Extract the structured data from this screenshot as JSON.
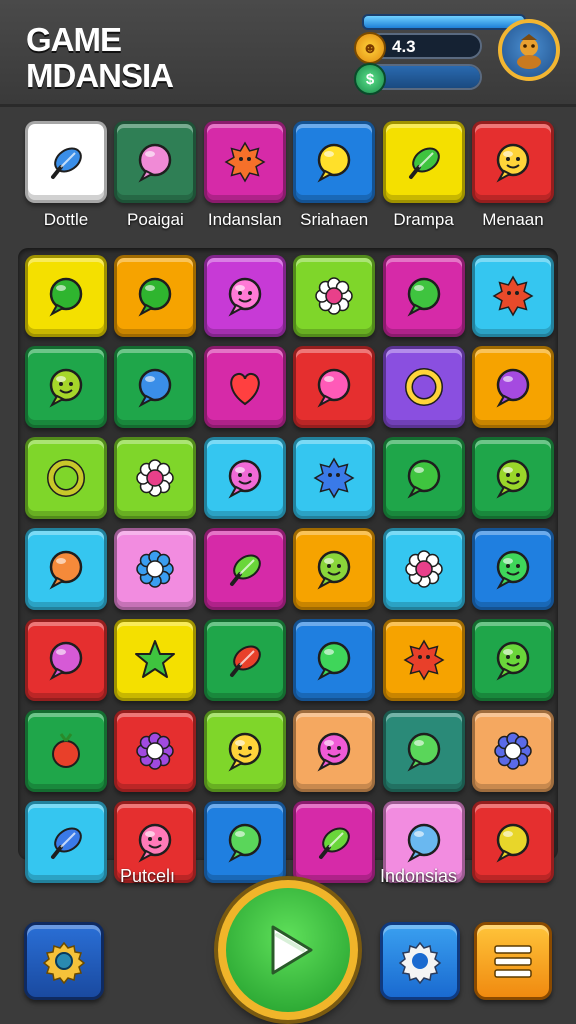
{
  "header": {
    "title_line1": "GAME",
    "title_line2": "MDANSIA",
    "rating_value": "4.3",
    "rating_icon": "star-face-icon",
    "energy_icon": "energy-coin-icon",
    "avatar_icon": "character-avatar-icon"
  },
  "colors": {
    "yellow": "#f4e000",
    "orange": "#f6a300",
    "purple": "#c73ad6",
    "lime": "#7fd62a",
    "magenta": "#d62aa8",
    "cyan": "#35c6f0",
    "green": "#1fa64a",
    "darkgreen": "#2f7f55",
    "red": "#e52f2f",
    "blue": "#1f7fe0",
    "pink": "#f28ce0",
    "violet": "#8a4fe0",
    "white": "#ffffff",
    "peach": "#f5a860",
    "teal": "#2a8a78"
  },
  "categories": [
    {
      "label": "Dottle",
      "color": "white",
      "icon": "blue-fish-icon"
    },
    {
      "label": "Poaigai",
      "color": "darkgreen",
      "icon": "pink-blob-icon"
    },
    {
      "label": "Indanslan",
      "color": "magenta",
      "icon": "orange-sun-icon"
    },
    {
      "label": "Sriahaen",
      "color": "blue",
      "icon": "yellow-bubble-icon"
    },
    {
      "label": "Drampa",
      "color": "yellow",
      "icon": "green-leaf-icon"
    },
    {
      "label": "Menaan",
      "color": "red",
      "icon": "smiley-face-icon"
    }
  ],
  "board": [
    [
      {
        "color": "yellow",
        "icon": "green-bubble-icon",
        "glyph": "#2fb52f"
      },
      {
        "color": "orange",
        "icon": "green-bubble-icon",
        "glyph": "#2fb52f"
      },
      {
        "color": "purple",
        "icon": "pink-smiley-icon",
        "glyph": "#ff7ad6"
      },
      {
        "color": "lime",
        "icon": "white-flower-icon",
        "glyph": "#ffffff"
      },
      {
        "color": "magenta",
        "icon": "green-bubble-icon",
        "glyph": "#3fc43f"
      },
      {
        "color": "cyan",
        "icon": "red-splat-icon",
        "glyph": "#e84a2a"
      }
    ],
    [
      {
        "color": "green",
        "icon": "smiley-face-icon",
        "glyph": "#a6d62a"
      },
      {
        "color": "green",
        "icon": "blue-bubble-icon",
        "glyph": "#3a8ee8"
      },
      {
        "color": "magenta",
        "icon": "red-heart-icon",
        "glyph": "#ff4040"
      },
      {
        "color": "red",
        "icon": "pink-bubble-icon",
        "glyph": "#ff5ab8"
      },
      {
        "color": "violet",
        "icon": "yellow-ring-icon",
        "glyph": "#ffd43a"
      },
      {
        "color": "orange",
        "icon": "purple-bubble-icon",
        "glyph": "#a54ae0"
      }
    ],
    [
      {
        "color": "lime",
        "icon": "yellow-ring-icon",
        "glyph": "#c8c82a"
      },
      {
        "color": "lime",
        "icon": "white-flower-icon",
        "glyph": "#ffffff"
      },
      {
        "color": "cyan",
        "icon": "pink-smiley-icon",
        "glyph": "#f06ad6"
      },
      {
        "color": "cyan",
        "icon": "blue-splat-icon",
        "glyph": "#3a7ae8"
      },
      {
        "color": "green",
        "icon": "green-bubble-icon",
        "glyph": "#3fc43f"
      },
      {
        "color": "green",
        "icon": "smiley-face-icon",
        "glyph": "#9ad62a"
      }
    ],
    [
      {
        "color": "cyan",
        "icon": "orange-bubble-icon",
        "glyph": "#f58a3a"
      },
      {
        "color": "pink",
        "icon": "blue-flower-icon",
        "glyph": "#3a9ef0"
      },
      {
        "color": "magenta",
        "icon": "green-leaf-icon",
        "glyph": "#6ad63a"
      },
      {
        "color": "orange",
        "icon": "smiley-face-icon",
        "glyph": "#8ad63a"
      },
      {
        "color": "cyan",
        "icon": "white-flower-icon",
        "glyph": "#ffffff"
      },
      {
        "color": "blue",
        "icon": "smiley-face-icon",
        "glyph": "#3fd65a"
      }
    ],
    [
      {
        "color": "red",
        "icon": "pink-bubble-icon",
        "glyph": "#d65ad6"
      },
      {
        "color": "yellow",
        "icon": "green-star-icon",
        "glyph": "#3fc43f"
      },
      {
        "color": "green",
        "icon": "red-leaf-icon",
        "glyph": "#e8402a"
      },
      {
        "color": "blue",
        "icon": "green-bubble-icon",
        "glyph": "#3fd65a"
      },
      {
        "color": "orange",
        "icon": "red-sun-icon",
        "glyph": "#e8402a"
      },
      {
        "color": "green",
        "icon": "smiley-face-icon",
        "glyph": "#6ad63a"
      }
    ],
    [
      {
        "color": "green",
        "icon": "red-berry-icon",
        "glyph": "#e8402a"
      },
      {
        "color": "red",
        "icon": "purple-flower-icon",
        "glyph": "#a04ae0"
      },
      {
        "color": "lime",
        "icon": "smiley-face-icon",
        "glyph": "#ffd43a"
      },
      {
        "color": "peach",
        "icon": "pink-smiley-icon",
        "glyph": "#f05ad6"
      },
      {
        "color": "teal",
        "icon": "green-bubble-icon",
        "glyph": "#5ad65a"
      },
      {
        "color": "peach",
        "icon": "blue-flower-icon",
        "glyph": "#5a6ae8"
      }
    ],
    [
      {
        "color": "cyan",
        "icon": "blue-fish-icon",
        "glyph": "#3a7ae8"
      },
      {
        "color": "red",
        "icon": "pink-smiley-icon",
        "glyph": "#ff7ab8"
      },
      {
        "color": "blue",
        "icon": "green-bubble-icon",
        "glyph": "#5ad65a"
      },
      {
        "color": "magenta",
        "icon": "green-leaf-icon",
        "glyph": "#6ad63a"
      },
      {
        "color": "pink",
        "icon": "blue-bubble-icon",
        "glyph": "#6ab8f0"
      },
      {
        "color": "red",
        "icon": "yellow-bubble-icon",
        "glyph": "#e8d62a"
      }
    ]
  ],
  "footer": {
    "left_label": "Putcelı",
    "right_label": "Indonsias",
    "buttons": [
      {
        "icon": "gear-icon"
      },
      {
        "icon": "play-arrow-icon"
      },
      {
        "icon": "settings-gear-icon"
      },
      {
        "icon": "menu-icon"
      }
    ]
  }
}
